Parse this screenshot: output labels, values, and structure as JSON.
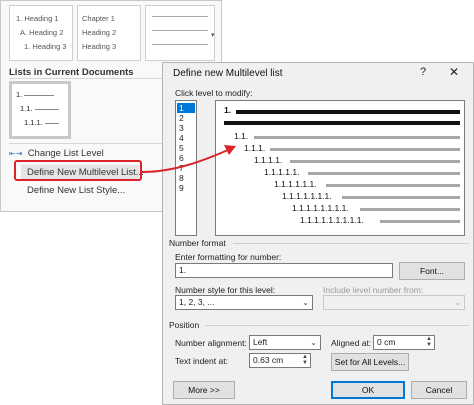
{
  "menu": {
    "gallery": [
      {
        "lines": [
          "1. Heading 1",
          "A. Heading 2",
          "1. Heading 3"
        ]
      },
      {
        "lines": [
          "Chapter 1",
          "Heading 2",
          "Heading 3"
        ]
      }
    ],
    "section_label": "Lists in Current Documents",
    "current_list": [
      "1.",
      "1.1.",
      "1.1.1."
    ],
    "items": {
      "change_level": "Change List Level",
      "define_new": "Define New Multilevel List...",
      "define_style": "Define New List Style..."
    }
  },
  "dialog": {
    "title": "Define new Multilevel list",
    "help": "?",
    "close": "✕",
    "click_level_label": "Click level to modify:",
    "levels": [
      "1",
      "2",
      "3",
      "4",
      "5",
      "6",
      "7",
      "8",
      "9"
    ],
    "selected_level": "1",
    "preview_numbers": [
      "1.",
      "1.1.",
      "1.1.1.",
      "1.1.1.1.",
      "1.1.1.1.1.",
      "1.1.1.1.1.1.",
      "1.1.1.1.1.1.1.",
      "1.1.1.1.1.1.1.1.",
      "1.1.1.1.1.1.1.1.1."
    ],
    "number_format": {
      "group": "Number format",
      "enter_formatting_label": "Enter formatting for number:",
      "formatting_value": "1.",
      "font_button": "Font...",
      "style_label": "Number style for this level:",
      "style_value": "1, 2, 3, ...",
      "include_label": "Include level number from:",
      "include_value": ""
    },
    "position": {
      "group": "Position",
      "alignment_label": "Number alignment:",
      "alignment_value": "Left",
      "aligned_at_label": "Aligned at:",
      "aligned_at_value": "0 cm",
      "indent_label": "Text indent at:",
      "indent_value": "0.63 cm",
      "set_all_button": "Set for All Levels..."
    },
    "more_button": "More >>",
    "ok_button": "OK",
    "cancel_button": "Cancel"
  },
  "colors": {
    "highlight": "#d9252a",
    "selection": "#0078d7"
  }
}
